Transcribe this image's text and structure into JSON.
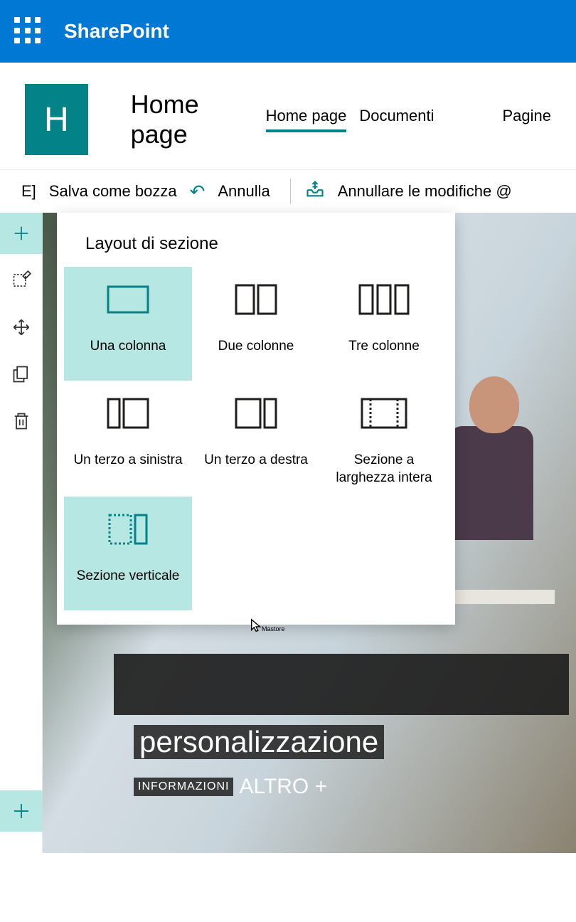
{
  "suite": {
    "title": "SharePoint"
  },
  "site": {
    "logoLetter": "H",
    "pageTitle": "Home page",
    "tabs": [
      "Home page",
      "Documenti",
      "Pagine"
    ],
    "activeTab": 0
  },
  "commandBar": {
    "leadingChar": "E]",
    "saveDraft": "Salva come bozza",
    "undo": "Annulla",
    "discardChanges": "Annullare le modifiche @"
  },
  "layoutFlyout": {
    "title": "Layout di sezione",
    "options": [
      {
        "label": "Una colonna"
      },
      {
        "label": "Due colonne"
      },
      {
        "label": "Tre colonne"
      },
      {
        "label": "Un terzo a sinistra"
      },
      {
        "label": "Un terzo a destra"
      },
      {
        "label": "Sezione a larghezza intera"
      },
      {
        "label": "Sezione verticale"
      }
    ]
  },
  "hero": {
    "line2": "personalizzazione",
    "badge": "INFORMAZIONI",
    "more": "ALTRO +"
  },
  "cursor": {
    "tooltip": "Mastore"
  }
}
